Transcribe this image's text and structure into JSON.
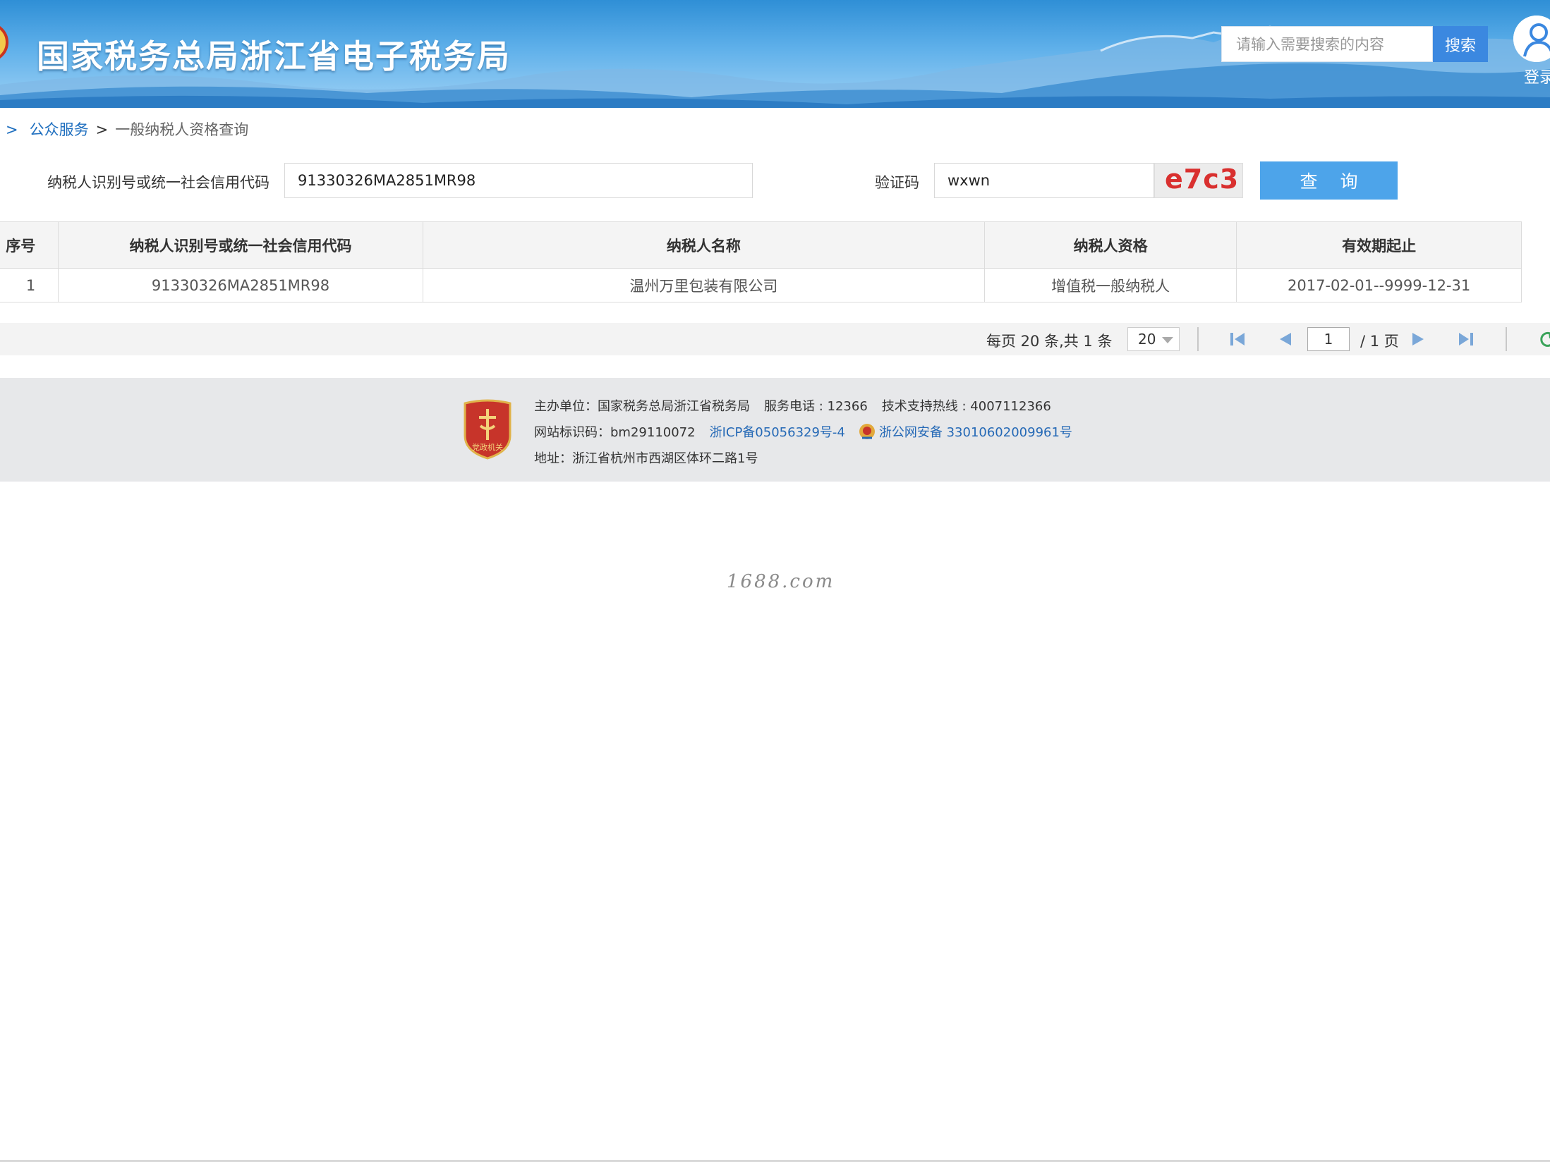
{
  "header": {
    "site_title": "国家税务总局浙江省电子税务局",
    "search_placeholder": "请输入需要搜索的内容",
    "search_button": "搜索",
    "login_label": "登录"
  },
  "breadcrumb": {
    "lead_separator": ">",
    "items": [
      {
        "label": "公众服务"
      },
      {
        "label": "一般纳税人资格查询"
      }
    ],
    "separator": ">"
  },
  "query_form": {
    "taxpayer_id_label": "纳税人识别号或统一社会信用代码",
    "taxpayer_id_value": "91330326MA2851MR98",
    "captcha_label": "验证码",
    "captcha_value": "wxwn",
    "captcha_image_text": "e7c3",
    "submit_label": "查 询"
  },
  "results_table": {
    "columns": [
      "序号",
      "纳税人识别号或统一社会信用代码",
      "纳税人名称",
      "纳税人资格",
      "有效期起止"
    ],
    "rows": [
      [
        "1",
        "91330326MA2851MR98",
        "温州万里包装有限公司",
        "增值税一般纳税人",
        "2017-02-01--9999-12-31"
      ]
    ]
  },
  "pagination": {
    "summary": "每页 20 条,共 1 条",
    "page_size": "20",
    "current_page": "1",
    "total_pages_label": "/ 1 页"
  },
  "footer": {
    "host_label": "主办单位：国家税务总局浙江省税务局",
    "service_phone": "服务电话 : 12366",
    "support_hotline": "技术支持热线 : 4007112366",
    "site_code": "网站标识码：bm29110072",
    "icp": "浙ICP备05056329号-4",
    "police_record": "浙公网安备 33010602009961号",
    "address": "地址：浙江省杭州市西湖区体环二路1号",
    "badge_text": "党政机关"
  },
  "watermark": "1688.com",
  "colors": {
    "header_blue": "#2f8fd6",
    "button_blue": "#3b88e0",
    "query_button": "#4da4ea",
    "link_blue": "#1f6fbf",
    "captcha_red": "#d9302f",
    "badge_red": "#c7342a"
  },
  "icons": {
    "emblem": "national-emblem-icon",
    "login": "user-avatar-icon",
    "first_page": "first-page-icon",
    "prev_page": "prev-page-icon",
    "next_page": "next-page-icon",
    "last_page": "last-page-icon",
    "refresh": "refresh-icon",
    "police": "police-badge-icon"
  }
}
